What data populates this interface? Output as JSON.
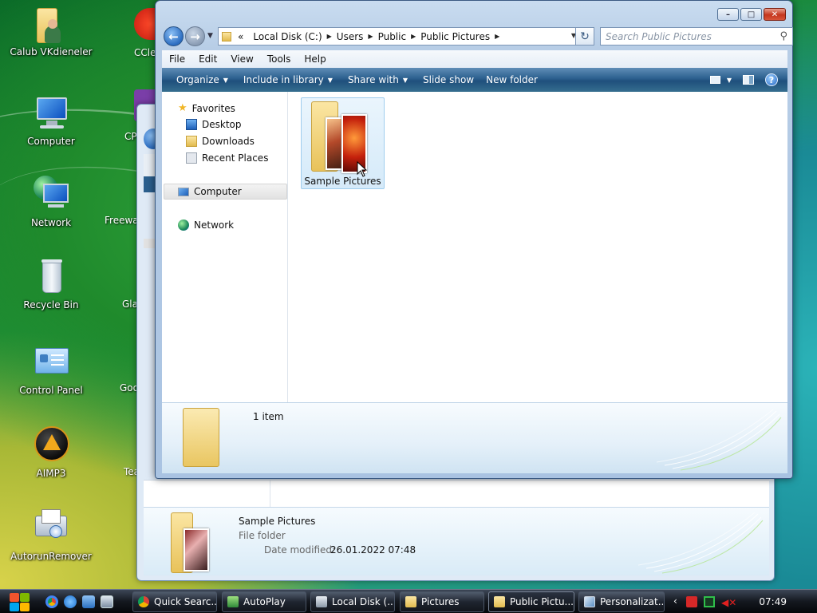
{
  "desktop": {
    "icons": [
      {
        "label": "Calub VKdieneler"
      },
      {
        "label": "Computer"
      },
      {
        "label": "Network"
      },
      {
        "label": "Recycle Bin"
      },
      {
        "label": "Control Panel"
      },
      {
        "label": "AIMP3"
      },
      {
        "label": "AutorunRemover"
      }
    ],
    "clipped_labels": [
      "CCle",
      "CP",
      "Freewa",
      "Gla",
      "Goo",
      "Tea"
    ]
  },
  "background_window": {
    "details": {
      "name": "Sample Pictures",
      "type": "File folder",
      "date_label": "Date modified:",
      "date_value": "26.01.2022 07:48"
    }
  },
  "window": {
    "controls": {
      "minimize": "–",
      "maximize": "□",
      "close": "✕"
    },
    "address": {
      "prefix": "«",
      "crumbs": [
        "Local Disk (C:)",
        "Users",
        "Public",
        "Public Pictures"
      ]
    },
    "search_placeholder": "Search Public Pictures",
    "menu": [
      "File",
      "Edit",
      "View",
      "Tools",
      "Help"
    ],
    "commands": [
      "Organize",
      "Include in library",
      "Share with",
      "Slide show",
      "New folder"
    ],
    "help_label": "?",
    "nav_pane": {
      "favorites": "Favorites",
      "fav_items": [
        "Desktop",
        "Downloads",
        "Recent Places"
      ],
      "computer": "Computer",
      "network": "Network"
    },
    "files": [
      {
        "name": "Sample Pictures"
      }
    ],
    "status": {
      "count": "1 item"
    }
  },
  "taskbar": {
    "buttons": [
      "Quick Searc...",
      "AutoPlay",
      "Local Disk (...",
      "Pictures",
      "Public Pictu...",
      "Personalizat..."
    ],
    "active_index": 4,
    "clock": "07:49"
  }
}
